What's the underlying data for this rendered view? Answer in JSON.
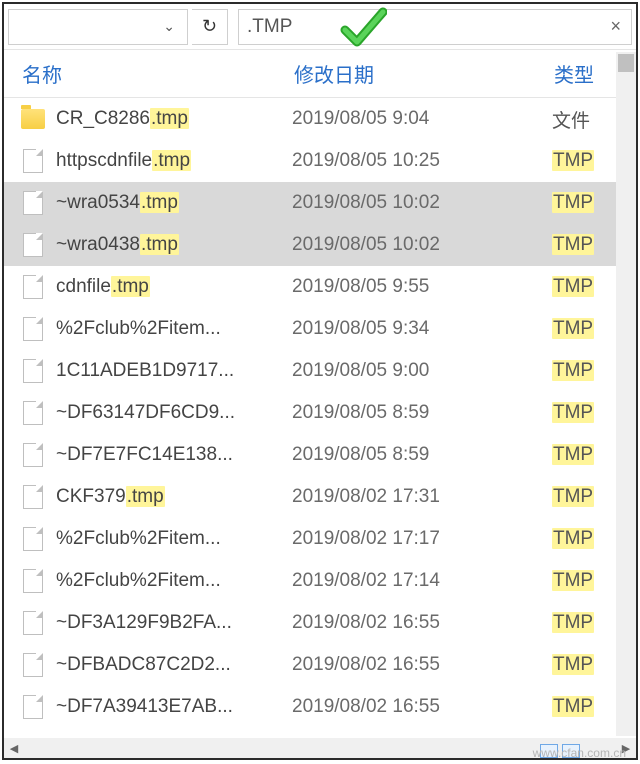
{
  "toolbar": {
    "search_value": ".TMP",
    "refresh_glyph": "↻",
    "dropdown_glyph": "⌄",
    "clear_glyph": "×"
  },
  "columns": {
    "name": "名称",
    "date": "修改日期",
    "type": "类型"
  },
  "files": [
    {
      "icon": "folder",
      "name_pre": "CR_C8286",
      "name_hl": ".tmp",
      "name_post": "",
      "date": "2019/08/05 9:04",
      "type": "文件",
      "type_hl": false,
      "selected": false
    },
    {
      "icon": "file",
      "name_pre": "httpscdnfile",
      "name_hl": ".tmp",
      "name_post": "",
      "date": "2019/08/05 10:25",
      "type": "TMP",
      "type_hl": true,
      "selected": false
    },
    {
      "icon": "file",
      "name_pre": "~wra0534",
      "name_hl": ".tmp",
      "name_post": "",
      "date": "2019/08/05 10:02",
      "type": "TMP",
      "type_hl": true,
      "selected": true
    },
    {
      "icon": "file",
      "name_pre": "~wra0438",
      "name_hl": ".tmp",
      "name_post": "",
      "date": "2019/08/05 10:02",
      "type": "TMP",
      "type_hl": true,
      "selected": true
    },
    {
      "icon": "file",
      "name_pre": "cdnfile",
      "name_hl": ".tmp",
      "name_post": "",
      "date": "2019/08/05 9:55",
      "type": "TMP",
      "type_hl": true,
      "selected": false
    },
    {
      "icon": "file",
      "name_pre": "%2Fclub%2Fitem...",
      "name_hl": "",
      "name_post": "",
      "date": "2019/08/05 9:34",
      "type": "TMP",
      "type_hl": true,
      "selected": false
    },
    {
      "icon": "file",
      "name_pre": "1C11ADEB1D9717...",
      "name_hl": "",
      "name_post": "",
      "date": "2019/08/05 9:00",
      "type": "TMP",
      "type_hl": true,
      "selected": false
    },
    {
      "icon": "file",
      "name_pre": "~DF63147DF6CD9...",
      "name_hl": "",
      "name_post": "",
      "date": "2019/08/05 8:59",
      "type": "TMP",
      "type_hl": true,
      "selected": false
    },
    {
      "icon": "file",
      "name_pre": "~DF7E7FC14E138...",
      "name_hl": "",
      "name_post": "",
      "date": "2019/08/05 8:59",
      "type": "TMP",
      "type_hl": true,
      "selected": false
    },
    {
      "icon": "file",
      "name_pre": "CKF379",
      "name_hl": ".tmp",
      "name_post": "",
      "date": "2019/08/02 17:31",
      "type": "TMP",
      "type_hl": true,
      "selected": false
    },
    {
      "icon": "file",
      "name_pre": "%2Fclub%2Fitem...",
      "name_hl": "",
      "name_post": "",
      "date": "2019/08/02 17:17",
      "type": "TMP",
      "type_hl": true,
      "selected": false
    },
    {
      "icon": "file",
      "name_pre": "%2Fclub%2Fitem...",
      "name_hl": "",
      "name_post": "",
      "date": "2019/08/02 17:14",
      "type": "TMP",
      "type_hl": true,
      "selected": false
    },
    {
      "icon": "file",
      "name_pre": "~DF3A129F9B2FA...",
      "name_hl": "",
      "name_post": "",
      "date": "2019/08/02 16:55",
      "type": "TMP",
      "type_hl": true,
      "selected": false
    },
    {
      "icon": "file",
      "name_pre": "~DFBADC87C2D2...",
      "name_hl": "",
      "name_post": "",
      "date": "2019/08/02 16:55",
      "type": "TMP",
      "type_hl": true,
      "selected": false
    },
    {
      "icon": "file",
      "name_pre": "~DF7A39413E7AB...",
      "name_hl": "",
      "name_post": "",
      "date": "2019/08/02 16:55",
      "type": "TMP",
      "type_hl": true,
      "selected": false
    }
  ],
  "watermark": "www.cfan.com.cn"
}
